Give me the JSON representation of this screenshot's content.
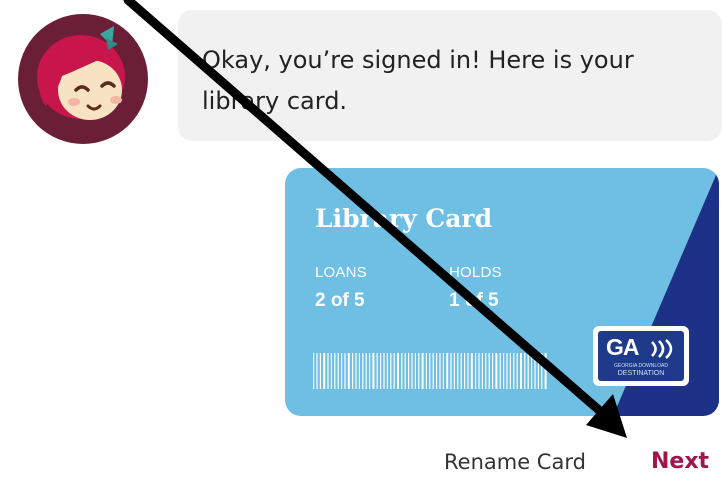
{
  "message": {
    "text": "Okay, you’re signed in! Here is your library card."
  },
  "card": {
    "title": "Library Card",
    "loans_label": "LOANS",
    "loans_value": "2 of 5",
    "holds_label": "HOLDS",
    "holds_value": "1 of 5",
    "logo": {
      "name": "GA",
      "line1": "GEORGIA DOWNLOAD",
      "line2": "DESTINATION"
    },
    "colors": {
      "card_light": "#6fbfe5",
      "card_dark": "#1d3286",
      "badge_blue": "#1f3a8a"
    }
  },
  "actions": {
    "rename_label": "Rename Card",
    "next_label": "Next",
    "next_color": "#a0154d"
  },
  "icons": {
    "avatar": "libby-character-avatar",
    "pointer": "arrow-pointer-icon"
  }
}
